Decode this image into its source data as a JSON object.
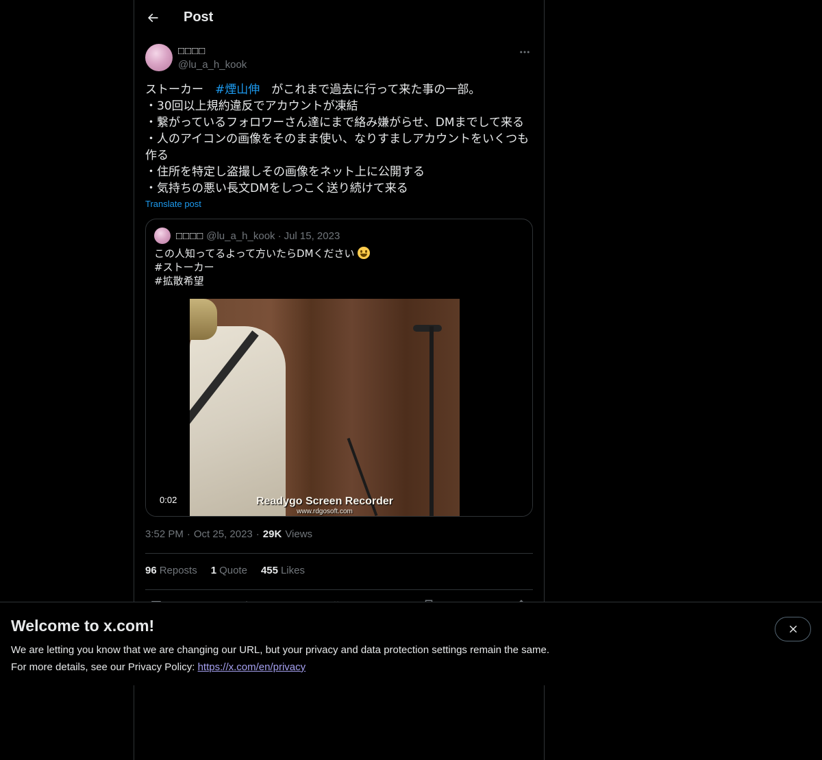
{
  "header": {
    "title": "Post"
  },
  "post": {
    "author": {
      "display_name": "□□□□",
      "handle": "@lu_a_h_kook"
    },
    "text": {
      "line1_prefix": "ストーカー　",
      "hashtag": "#煙山伸",
      "line1_suffix": "　がこれまで過去に行って来た事の一部。",
      "line2": "・30回以上規約違反でアカウントが凍結",
      "line3": "・繋がっているフォロワーさん達にまで絡み嫌がらせ、DMまでして来る",
      "line4": "・人のアイコンの画像をそのまま使い、なりすましアカウントをいくつも作る",
      "line5": "・住所を特定し盗撮しその画像をネット上に公開する",
      "line6": "・気持ちの悪い長文DMをしつこく送り続けて来る"
    },
    "translate_label": "Translate post",
    "quote": {
      "display_name": "□□□□",
      "handle": "@lu_a_h_kook",
      "separator": "·",
      "date": "Jul 15, 2023",
      "text_line1": "この人知ってるよって方いたらDMください",
      "text_line2": "#ストーカー",
      "text_line3": "#拡散希望",
      "video": {
        "duration": "0:02",
        "watermark_title": "Readygo Screen Recorder",
        "watermark_url": "www.rdgosoft.com"
      }
    },
    "meta": {
      "time": "3:52 PM",
      "sep1": "·",
      "date": "Oct 25, 2023",
      "sep2": "·",
      "views_count": "29K",
      "views_label": "Views"
    },
    "stats": {
      "reposts_count": "96",
      "reposts_label": "Reposts",
      "quotes_count": "1",
      "quotes_label": "Quote",
      "likes_count": "455",
      "likes_label": "Likes"
    }
  },
  "banner": {
    "title": "Welcome to x.com!",
    "body_line1": "We are letting you know that we are changing our URL, but your privacy and data protection settings remain the same.",
    "body_line2_prefix": "For more details, see our Privacy Policy: ",
    "link": "https://x.com/en/privacy"
  },
  "icons": [
    "back-arrow-icon",
    "more-icon",
    "reply-icon",
    "repost-icon",
    "like-icon",
    "bookmark-icon",
    "share-icon",
    "close-icon",
    "smiley-emoji-icon"
  ]
}
